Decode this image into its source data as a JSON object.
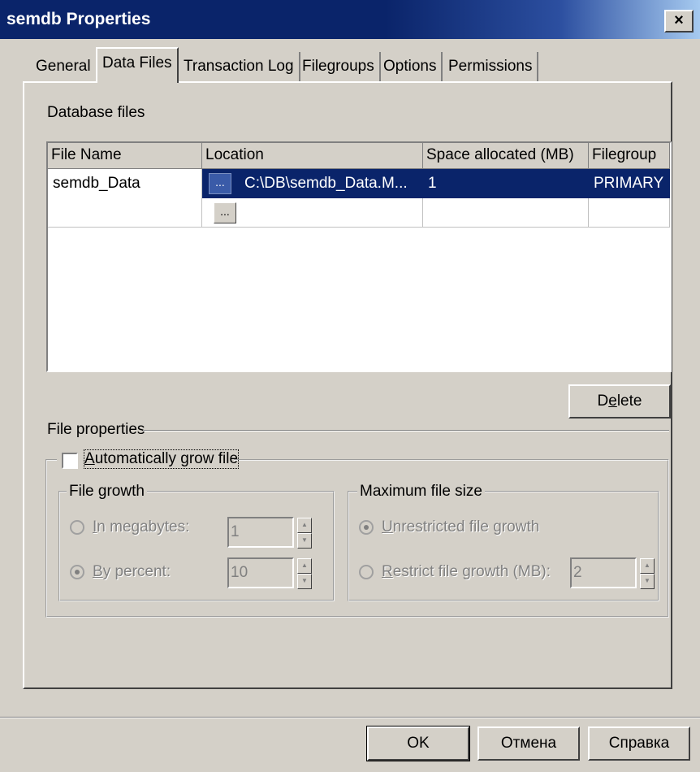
{
  "window": {
    "title": "semdb Properties",
    "close_glyph": "×"
  },
  "tabs": [
    {
      "label": "General",
      "active": false
    },
    {
      "label": "Data Files",
      "active": true
    },
    {
      "label": "Transaction Log",
      "active": false
    },
    {
      "label": "Filegroups",
      "active": false
    },
    {
      "label": "Options",
      "active": false
    },
    {
      "label": "Permissions",
      "active": false
    }
  ],
  "database_files": {
    "label": "Database files",
    "columns": [
      "File Name",
      "Location",
      "Space allocated (MB)",
      "Filegroup"
    ],
    "rows": [
      {
        "file_name": "semdb_Data",
        "browse": "...",
        "location": "C:\\DB\\semdb_Data.M...",
        "space": "1",
        "filegroup": "PRIMARY",
        "selected": true
      },
      {
        "file_name": "",
        "browse": "...",
        "location": "",
        "space": "",
        "filegroup": "",
        "selected": false
      }
    ],
    "delete_button": {
      "prefix": "D",
      "accel": "e",
      "suffix": "lete"
    }
  },
  "file_properties": {
    "label": "File properties",
    "auto_grow": {
      "prefix": "",
      "accel": "A",
      "suffix": "utomatically grow file",
      "checked": false
    },
    "file_growth": {
      "label": "File growth",
      "megabytes": {
        "accel": "I",
        "suffix": "n megabytes:",
        "selected": false,
        "value": "1"
      },
      "percent": {
        "accel": "B",
        "suffix": "y percent:",
        "selected": true,
        "value": "10"
      }
    },
    "max_size": {
      "label": "Maximum file size",
      "unrestricted": {
        "accel": "U",
        "suffix": "nrestricted file growth",
        "selected": true
      },
      "restrict": {
        "accel": "R",
        "suffix": "estrict file growth (MB):",
        "selected": false,
        "value": "2"
      }
    }
  },
  "footer": {
    "ok": "OK",
    "cancel": "Отмена",
    "help": "Справка"
  },
  "colors": {
    "titlebar": "#0a246a",
    "selection": "#0a246a",
    "face": "#d4d0c8"
  },
  "icons": {
    "spin_up": "▲",
    "spin_down": "▼"
  }
}
